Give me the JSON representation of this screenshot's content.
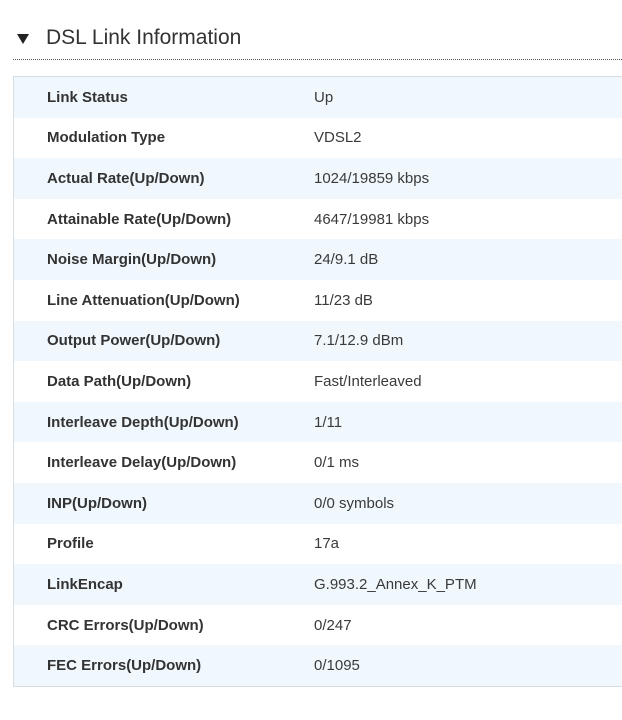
{
  "section": {
    "title": "DSL Link Information",
    "expanded": true
  },
  "rows": [
    {
      "label": "Link Status",
      "value": "Up"
    },
    {
      "label": "Modulation Type",
      "value": "VDSL2"
    },
    {
      "label": "Actual Rate(Up/Down)",
      "value": "1024/19859 kbps"
    },
    {
      "label": "Attainable Rate(Up/Down)",
      "value": "4647/19981 kbps"
    },
    {
      "label": "Noise Margin(Up/Down)",
      "value": "24/9.1 dB"
    },
    {
      "label": "Line Attenuation(Up/Down)",
      "value": "11/23 dB"
    },
    {
      "label": "Output Power(Up/Down)",
      "value": "7.1/12.9 dBm"
    },
    {
      "label": "Data Path(Up/Down)",
      "value": "Fast/Interleaved"
    },
    {
      "label": "Interleave Depth(Up/Down)",
      "value": "1/11"
    },
    {
      "label": "Interleave Delay(Up/Down)",
      "value": "0/1 ms"
    },
    {
      "label": "INP(Up/Down)",
      "value": "0/0 symbols"
    },
    {
      "label": "Profile",
      "value": "17a"
    },
    {
      "label": "LinkEncap",
      "value": "G.993.2_Annex_K_PTM"
    },
    {
      "label": "CRC Errors(Up/Down)",
      "value": "0/247"
    },
    {
      "label": "FEC Errors(Up/Down)",
      "value": "0/1095"
    }
  ],
  "colors": {
    "row_alt": "#f0f7fd",
    "border": "#d6dde3",
    "text": "#333333"
  },
  "icons": {
    "toggle": "triangle-down-icon"
  }
}
